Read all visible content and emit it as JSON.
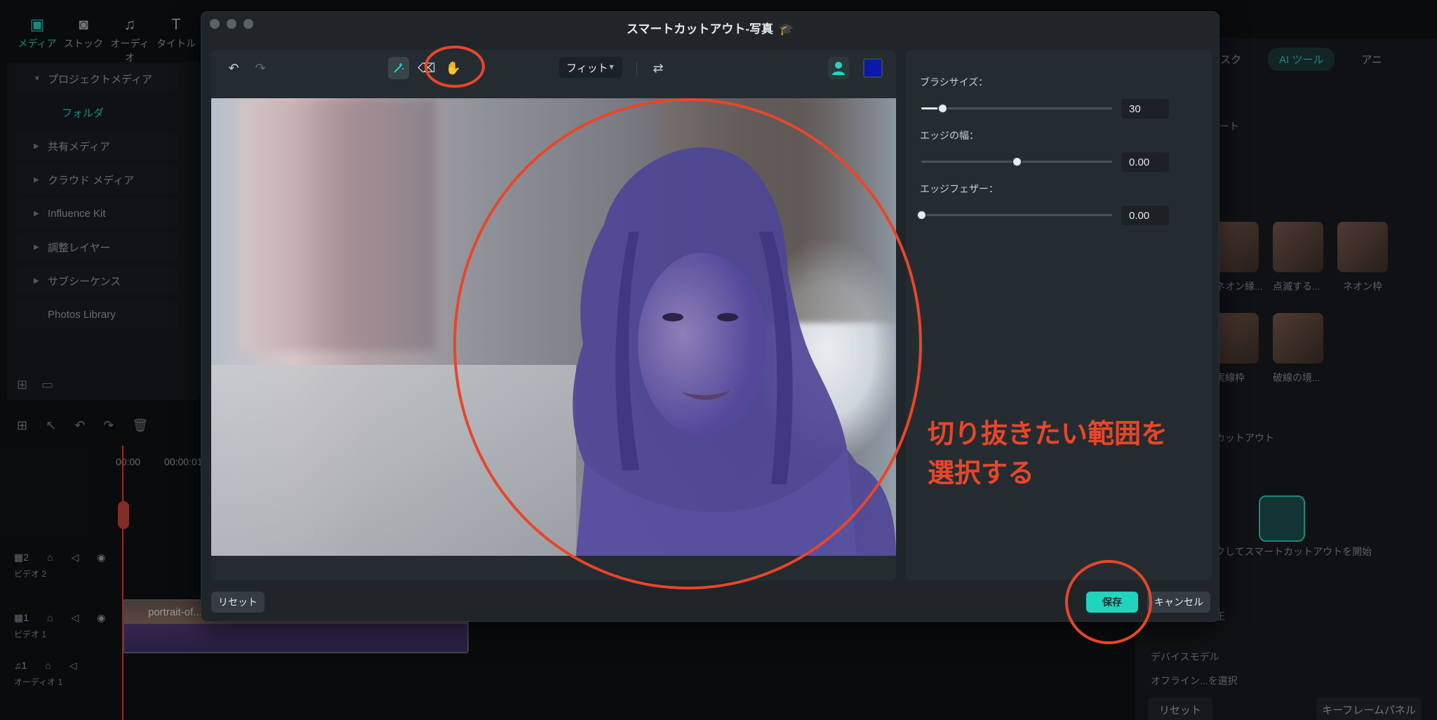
{
  "background": {
    "top_tabs": [
      {
        "label": "メディア",
        "icon": "media-icon",
        "active": true
      },
      {
        "label": "ストック",
        "icon": "stock-icon",
        "active": false
      },
      {
        "label": "オーディオ",
        "icon": "audio-icon",
        "active": false
      },
      {
        "label": "タイトル",
        "icon": "title-icon",
        "active": false
      }
    ],
    "media_items": [
      {
        "label": "プロジェクトメディア"
      },
      {
        "label": "フォルダ"
      },
      {
        "label": "共有メディア"
      },
      {
        "label": "クラウド メディア"
      },
      {
        "label": "Influence Kit"
      },
      {
        "label": "調整レイヤー"
      },
      {
        "label": "サブシーケンス"
      },
      {
        "label": "Photos Library"
      }
    ],
    "timeline": {
      "ruler": [
        "00:00",
        "00:00:01:"
      ],
      "tracks": [
        {
          "number": "2",
          "name": "ビデオ 2"
        },
        {
          "number": "1",
          "name": "ビデオ 1"
        },
        {
          "number": "1",
          "name": "オーディオ 1"
        }
      ],
      "clip_label": "portrait-of..."
    },
    "right_panel": {
      "tabs": [
        "マスク",
        "AI ツール",
        "アニ"
      ],
      "texts": [
        "レート",
        "ネオン縁...",
        "点滅する...",
        "ネオン枠",
        "実線枠",
        "破線の境...",
        "カットアウト",
        "クしてスマートカットアウトを開始",
        "正",
        "デバイスモデル",
        "オフライン...を選択"
      ],
      "reset_label": "リセット",
      "keyframe_label": "キーフレームパネル"
    }
  },
  "dialog": {
    "title": "スマートカットアウト-写真",
    "toolbar": {
      "fit_label": "フィット",
      "swatch_color": "#0a1aa8"
    },
    "settings": {
      "brush_size": {
        "label": "ブラシサイズ：",
        "value": "30",
        "fraction": 0.11
      },
      "edge_width": {
        "label": "エッジの幅：",
        "value": "0.00",
        "fraction": 0.5
      },
      "edge_feather": {
        "label": "エッジフェザー：",
        "value": "0.00",
        "fraction": 0.0
      }
    },
    "buttons": {
      "reset": "リセット",
      "save": "保存",
      "cancel": "キャンセル"
    }
  },
  "annotation": {
    "line1": "切り抜きたい範囲を",
    "line2": "選択する",
    "color": "#e8462a"
  }
}
